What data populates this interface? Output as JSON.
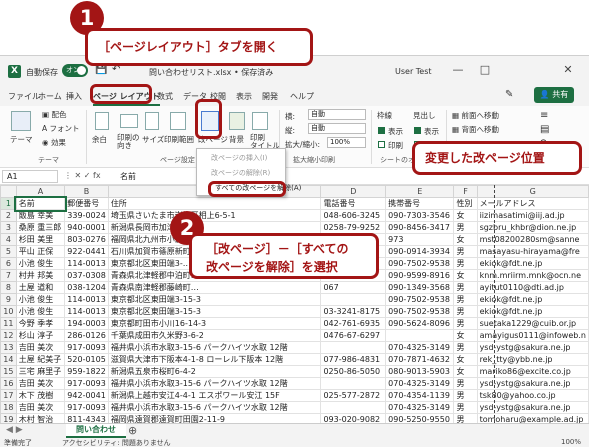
{
  "titlebar": {
    "autosave_label": "自動保存",
    "autosave_state": "オン",
    "filename": "問い合わせリスト.xlsx • 保存済み",
    "user": "User Test"
  },
  "menu": {
    "items": [
      "ファイル",
      "ホーム",
      "挿入",
      "ページ レイアウト",
      "数式",
      "データ",
      "校閲",
      "表示",
      "開発",
      "ヘルプ"
    ],
    "share_label": "共有"
  },
  "ribbon": {
    "theme_group": "テーマ",
    "theme_btn": "テーマ",
    "colors": "配色",
    "fonts": "フォント",
    "effects": "効果",
    "margins": "余白",
    "orientation": "印刷の\n向き",
    "size": "サイズ",
    "print_area": "印刷範囲",
    "breaks": "改ページ",
    "background": "背景",
    "print_titles": "印刷\nタイトル",
    "page_setup_group": "ページ設定",
    "width_label": "横:",
    "width_value": "自動",
    "height_label": "縦:",
    "height_value": "自動",
    "scale_label": "拡大/縮小:",
    "scale_value": "100%",
    "scale_group": "拡大縮小印刷",
    "gridlines": "枠線",
    "headings": "見出し",
    "view": "表示",
    "print": "印刷",
    "sheet_options_group": "シートのオプ",
    "bring_forward": "前面へ移動",
    "send_backward": "背面へ移動"
  },
  "dropdown": {
    "insert_break": "改ページの挿入(I)",
    "remove_break": "改ページの解除(R)",
    "reset_all": "すべての改ページを解除(A)"
  },
  "formula_bar": {
    "cell": "A1",
    "content": "名前"
  },
  "sheet": {
    "columns": [
      "A",
      "B",
      "C",
      "D",
      "E",
      "F",
      "G"
    ],
    "rows": [
      {
        "n": "1",
        "cells": [
          "名前",
          "郵便番号",
          "住所",
          "電話番号",
          "携帯番号",
          "性別",
          "メールアドレス"
        ]
      },
      {
        "n": "2",
        "cells": [
          "飯島 幸美",
          "339-0024",
          "埼玉県さいたま市岩槻区相上6-5-1",
          "048-606-3245",
          "090-7303-3546",
          "女",
          "iizimasatimi@iij.ad.jp"
        ]
      },
      {
        "n": "3",
        "cells": [
          "桑原 重三郎",
          "940-0001",
          "新潟県長岡市加津保町…",
          "0258-79-9252",
          "090-8456-3417",
          "男",
          "sgzbru_khbr@dion.ne.jp"
        ]
      },
      {
        "n": "4",
        "cells": [
          "杉田 美里",
          "803-0276",
          "福岡県北九州市小倉南区…",
          "",
          "973",
          "女",
          "mst08200280sm@sanne"
        ]
      },
      {
        "n": "5",
        "cells": [
          "平山 正保",
          "922-0441",
          "石川県加賀市篠原新町…",
          "",
          "090-0914-3934",
          "男",
          "masayasu-hirayama@fre"
        ]
      },
      {
        "n": "6",
        "cells": [
          "小池 俊生",
          "114-0013",
          "東京都北区東田端3-…",
          "",
          "090-7502-9538",
          "男",
          "ekiok@fdt.ne.jp"
        ]
      },
      {
        "n": "7",
        "cells": [
          "村井 邦美",
          "037-0308",
          "青森県北津軽郡中泊町…",
          "",
          "090-9599-8916",
          "女",
          "knm.mriirm.mnk@ocn.ne"
        ]
      },
      {
        "n": "8",
        "cells": [
          "土屋 道和",
          "038-1204",
          "青森県南津軽郡藤崎町…",
          "067",
          "090-1349-3568",
          "男",
          "ayitut0110@dti.ad.jp"
        ]
      },
      {
        "n": "9",
        "cells": [
          "小池 俊生",
          "114-0013",
          "東京都北区東田端3-15-3",
          "",
          "090-7502-9538",
          "男",
          "ekiok@fdt.ne.jp"
        ]
      },
      {
        "n": "10",
        "cells": [
          "小池 俊生",
          "114-0013",
          "東京都北区東田端3-15-3",
          "03-3241-8175",
          "090-7502-9538",
          "男",
          "ekiok@fdt.ne.jp"
        ]
      },
      {
        "n": "11",
        "cells": [
          "今野 季孝",
          "194-0003",
          "東京都町田市小川16-14-3",
          "042-761-6935",
          "090-5624-8096",
          "男",
          "suetaka1229@cuib.or.jp"
        ]
      },
      {
        "n": "12",
        "cells": [
          "杉山 淳子",
          "286-0126",
          "千葉県成田市久米野3-6-2",
          "0476-67-6297",
          "",
          "女",
          "amayigus0111@infoweb.n"
        ]
      },
      {
        "n": "13",
        "cells": [
          "吉田 美次",
          "917-0093",
          "福井県小浜市水取3-15-6 パークハイツ水取 12階",
          "",
          "070-4325-3149",
          "男",
          "ysd-ystg@sakura.ne.jp"
        ]
      },
      {
        "n": "14",
        "cells": [
          "土屋 紀美子",
          "520-0105",
          "滋賀県大津市下阪本4-1-8 ローレル下阪本 12階",
          "077-986-4831",
          "070-7871-4632",
          "女",
          "rek_tty@ybb.ne.jp"
        ]
      },
      {
        "n": "15",
        "cells": [
          "三宅 麻里子",
          "959-1822",
          "新潟県五泉市桜町6-4-2",
          "0250-86-5050",
          "080-9013-5903",
          "女",
          "mariko86@excite.co.jp"
        ]
      },
      {
        "n": "16",
        "cells": [
          "吉田 美次",
          "917-0093",
          "福井県小浜市水取3-15-6 パークハイツ水取 12階",
          "",
          "070-4325-3149",
          "男",
          "ysd-ystg@sakura.ne.jp"
        ]
      },
      {
        "n": "17",
        "cells": [
          "木下 茂樹",
          "942-0041",
          "新潟県上越市安江4-4-1 エスポワール安江 15F",
          "025-577-2872",
          "070-4354-1139",
          "男",
          "tsk80@yahoo.co.jp"
        ]
      },
      {
        "n": "18",
        "cells": [
          "吉田 美次",
          "917-0093",
          "福井県小浜市水取3-15-6 パークハイツ水取 12階",
          "",
          "070-4325-3149",
          "男",
          "ysd-ystg@sakura.ne.jp"
        ]
      },
      {
        "n": "19",
        "cells": [
          "木村 智治",
          "811-4343",
          "福岡県遠賀郡遠賀町田園2-11-9",
          "093-020-9082",
          "090-5250-9550",
          "男",
          "tomoharu@example.ad.jp"
        ]
      }
    ]
  },
  "sheet_tab": "問い合わせ",
  "status": {
    "ready": "準備完了",
    "accessibility": "アクセシビリティ: 問題ありません",
    "zoom": "100%"
  },
  "annotations": {
    "step1_number": "1",
    "step1_text": "［ページレイアウト］タブを開く",
    "step2_number": "2",
    "step2_line1": "［改ページ］－［すべての",
    "step2_line2": "改ページを解除］を選択",
    "note": "変更した改ページ位置"
  },
  "colors": {
    "excel_green": "#1d6f42",
    "annotation_red": "#a31515"
  }
}
